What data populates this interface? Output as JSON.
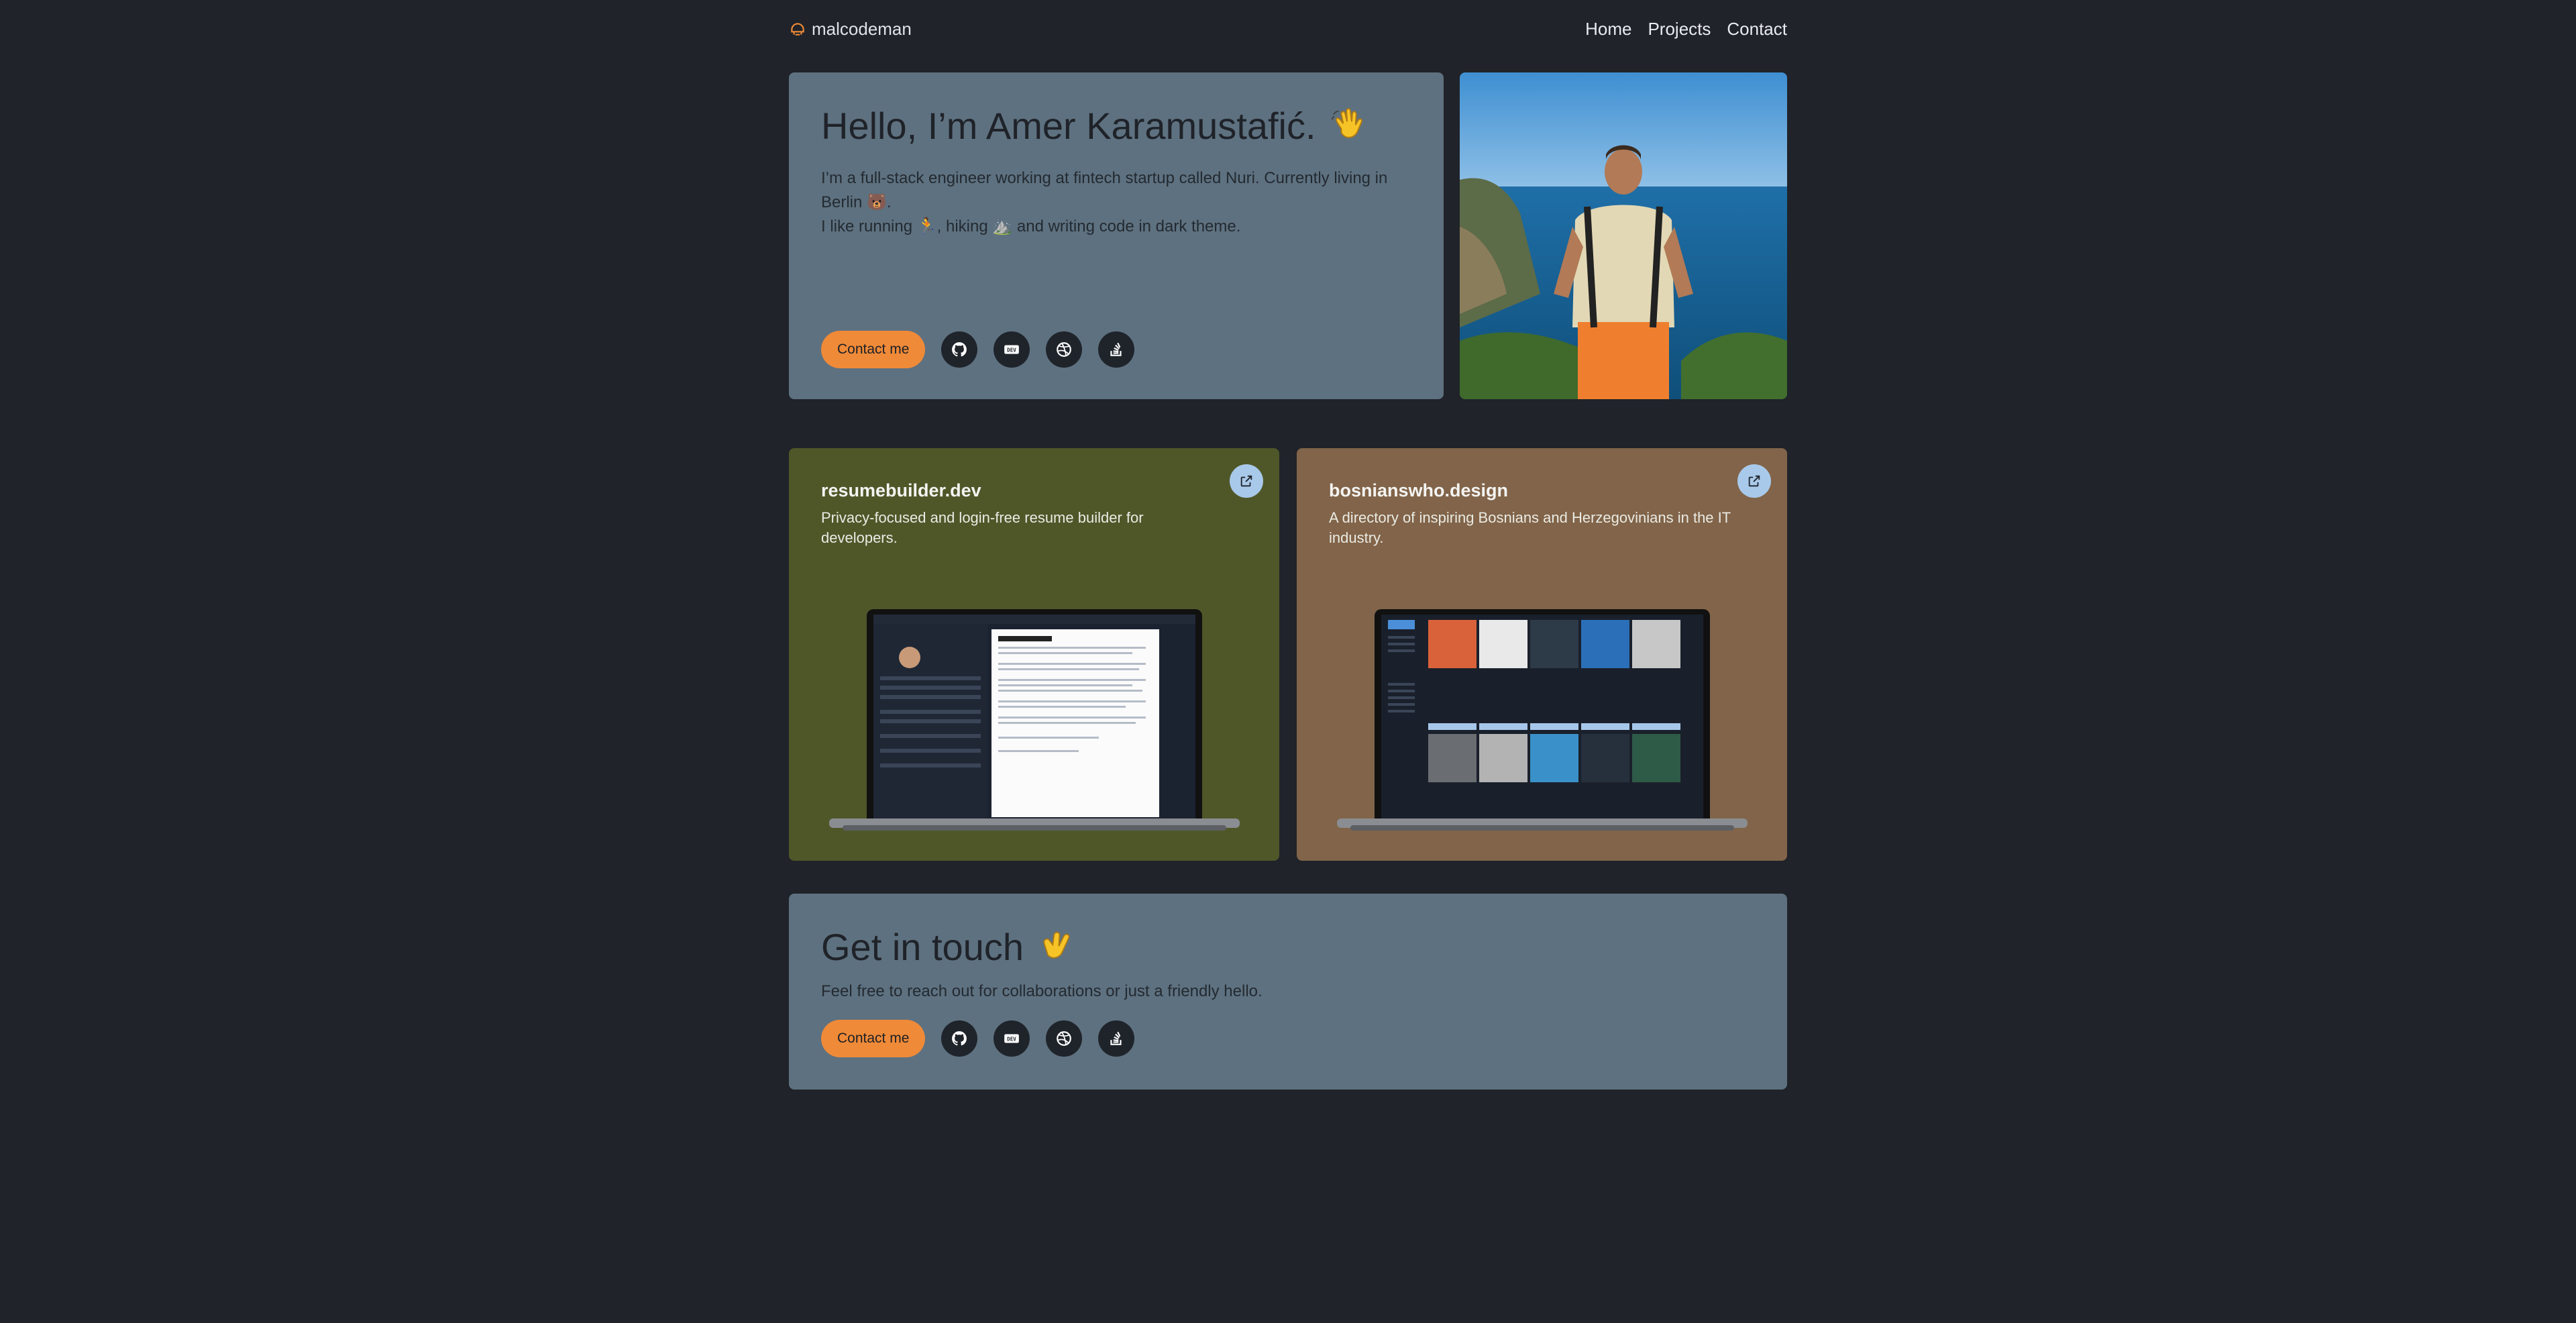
{
  "header": {
    "brand": "malcodeman",
    "nav": [
      "Home",
      "Projects",
      "Contact"
    ]
  },
  "hero": {
    "title": "Hello, I’m Amer Karamustafić.",
    "intro_line1": "I’m a full-stack engineer working at fintech startup called Nuri. Currently living in Berlin 🐻.",
    "intro_line2": "I like running 🏃, hiking ⛰️ and writing code in dark theme.",
    "contact_label": "Contact me"
  },
  "social": [
    "github-icon",
    "dev-icon",
    "dribbble-icon",
    "stackoverflow-icon"
  ],
  "projects": [
    {
      "title": "resumebuilder.dev",
      "description": "Privacy-focused and login-free resume builder for developers."
    },
    {
      "title": "bosnianswho.design",
      "description": "A directory of inspiring Bosnians and Herzegovinians in the IT industry."
    }
  ],
  "touch": {
    "title": "Get in touch",
    "description": "Feel free to reach out for collaborations or just a friendly hello.",
    "contact_label": "Contact me"
  },
  "colors": {
    "background": "#202329",
    "hero_card": "#5e7180",
    "project1_card": "#4f5729",
    "project2_card": "#816449",
    "accent": "#ef8a38"
  }
}
